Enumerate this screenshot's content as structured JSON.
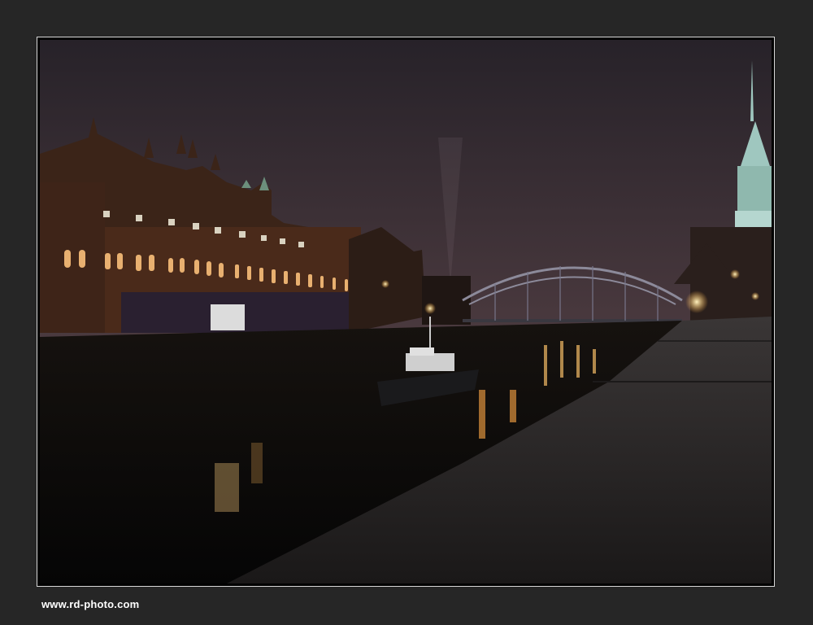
{
  "watermark": {
    "text": "www.rd-photo.com"
  },
  "photo": {
    "subject": "night-canal-scene",
    "colors": {
      "sky_top": "#2a2430",
      "sky_bottom": "#6a4a46",
      "water": "#0b0a0c",
      "stone_quay": "#2e2b2b",
      "tower_green": "#9fc7bf",
      "lamp_light": "#ffcf66"
    }
  }
}
